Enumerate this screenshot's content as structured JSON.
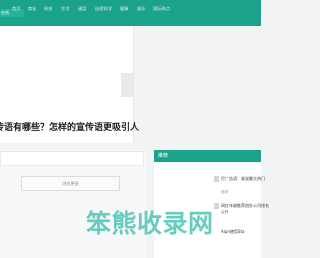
{
  "nav": {
    "items": [
      "首页",
      "商业",
      "科技",
      "生活",
      "速度",
      "自然科学",
      "健康",
      "娱乐",
      "国际热点"
    ]
  },
  "logo": {
    "text": "在线"
  },
  "slider": {
    "caption": "传语有哪些？怎样的宣传语更吸引人"
  },
  "list": {
    "more_label": "浏览更多"
  },
  "sidebar": {
    "title": "推荐",
    "items": [
      {
        "title": "打广告语：谁说最大热门",
        "meta": "推荐"
      },
      {
        "title": "网红年收推荐创办公司排名",
        "sub": "公开",
        "meta": ""
      },
      {
        "title": "Aipn使用Sta",
        "meta": ""
      }
    ]
  },
  "watermark": {
    "text": "笨熊收录网"
  },
  "colors": {
    "brand": "#1aa28b",
    "watermark": "#58c8b8"
  }
}
